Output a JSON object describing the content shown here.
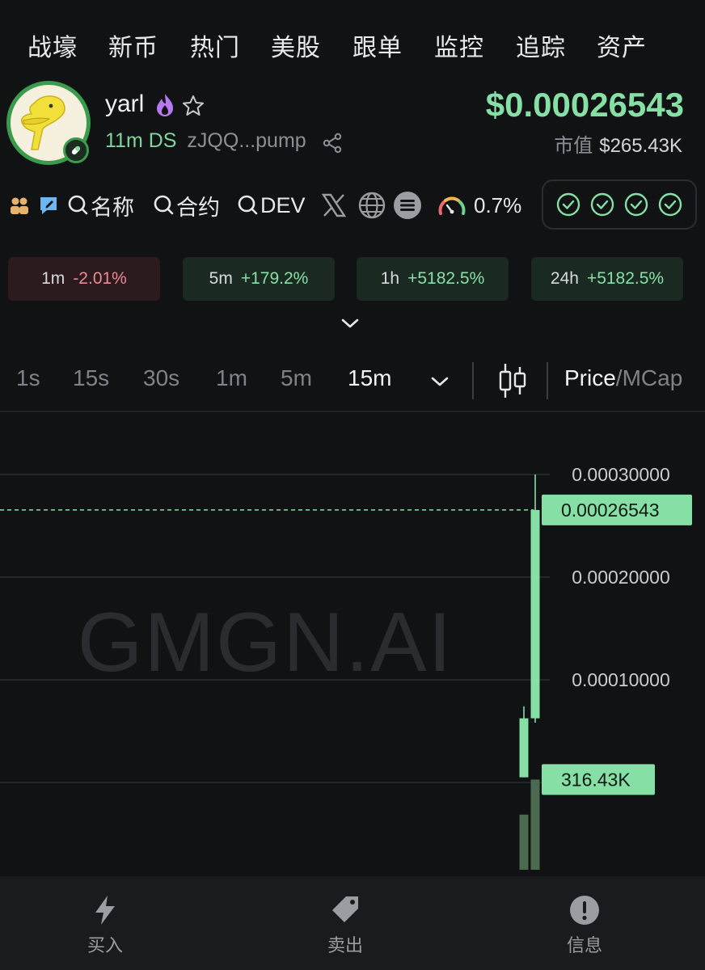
{
  "nav": {
    "items": [
      "战壕",
      "新币",
      "热门",
      "美股",
      "跟单",
      "监控",
      "追踪",
      "资产"
    ]
  },
  "token": {
    "name": "yarl",
    "age": "11m",
    "ds": "DS",
    "address": "zJQQ...pump",
    "price": "$0.00026543",
    "mcap_label": "市值",
    "mcap_value": "$265.43K"
  },
  "tools": {
    "search_name": "名称",
    "search_contract": "合约",
    "search_dev": "DEV",
    "gauge_value": "0.7%"
  },
  "changes": [
    {
      "tf": "1m",
      "value": "-2.01%",
      "tone": "neg"
    },
    {
      "tf": "5m",
      "value": "+179.2%",
      "tone": "pos"
    },
    {
      "tf": "1h",
      "value": "+5182.5%",
      "tone": "pos"
    },
    {
      "tf": "24h",
      "value": "+5182.5%",
      "tone": "pos"
    }
  ],
  "timeframes": {
    "items": [
      "1s",
      "15s",
      "30s",
      "1m",
      "5m",
      "15m"
    ],
    "active": "15m",
    "price_label": "Price",
    "slash": "/",
    "mcap_label": "MCap"
  },
  "chart_data": {
    "type": "candlestick",
    "watermark": "GMGN.AI",
    "y_ticks": [
      "0.00030000",
      "0.00020000",
      "0.00010000"
    ],
    "y_tick_values": [
      0.0003,
      0.0002,
      0.0001
    ],
    "current_price_label": "0.00026543",
    "current_price": 0.00026543,
    "volume_label": "316.43K",
    "candles": [
      {
        "open": 5.03e-06,
        "close": 6.25e-05,
        "high": 7.42e-05,
        "low": 5.03e-06
      },
      {
        "open": 6.25e-05,
        "close": 0.00026543,
        "high": 0.0003,
        "low": 5.83e-05
      }
    ],
    "volumes": [
      0.22,
      0.36
    ]
  },
  "bottom": {
    "buy": "买入",
    "sell": "卖出",
    "info": "信息"
  },
  "colors": {
    "up": "#86e0a5",
    "down": "#ec8a96",
    "accent_green": "#3a9b4d"
  }
}
